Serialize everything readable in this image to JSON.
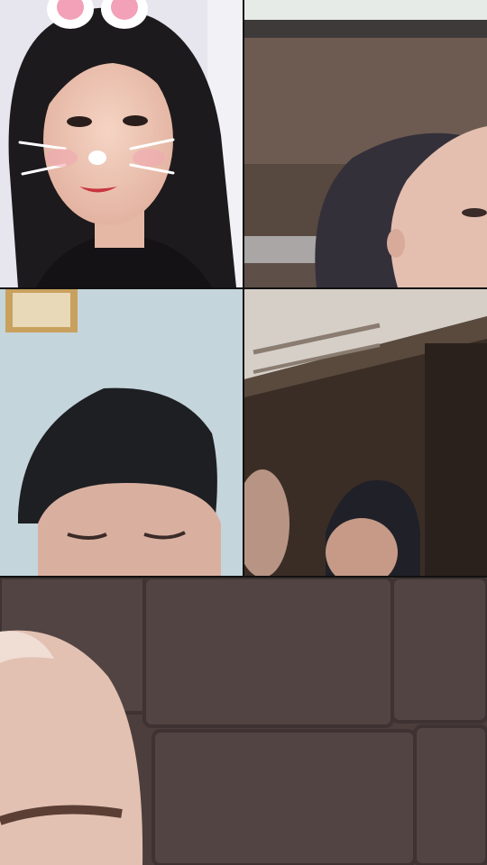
{
  "call": {
    "participant_count": 5,
    "tiles": [
      {
        "id": "participant-1",
        "filter": "bunny-ears-whiskers"
      },
      {
        "id": "participant-2",
        "filter": "none"
      },
      {
        "id": "participant-3",
        "filter": "none"
      },
      {
        "id": "participant-4",
        "filter": "none"
      },
      {
        "id": "participant-5",
        "filter": "none"
      }
    ]
  },
  "colors": {
    "divider": "#111111",
    "tile1_bg": "#e9e7ef",
    "tile2_bg": "#5f5049",
    "tile3_bg": "#c6d6dc",
    "tile4_bg": "#3d3028",
    "tile5_bg": "#4b3f3d"
  }
}
